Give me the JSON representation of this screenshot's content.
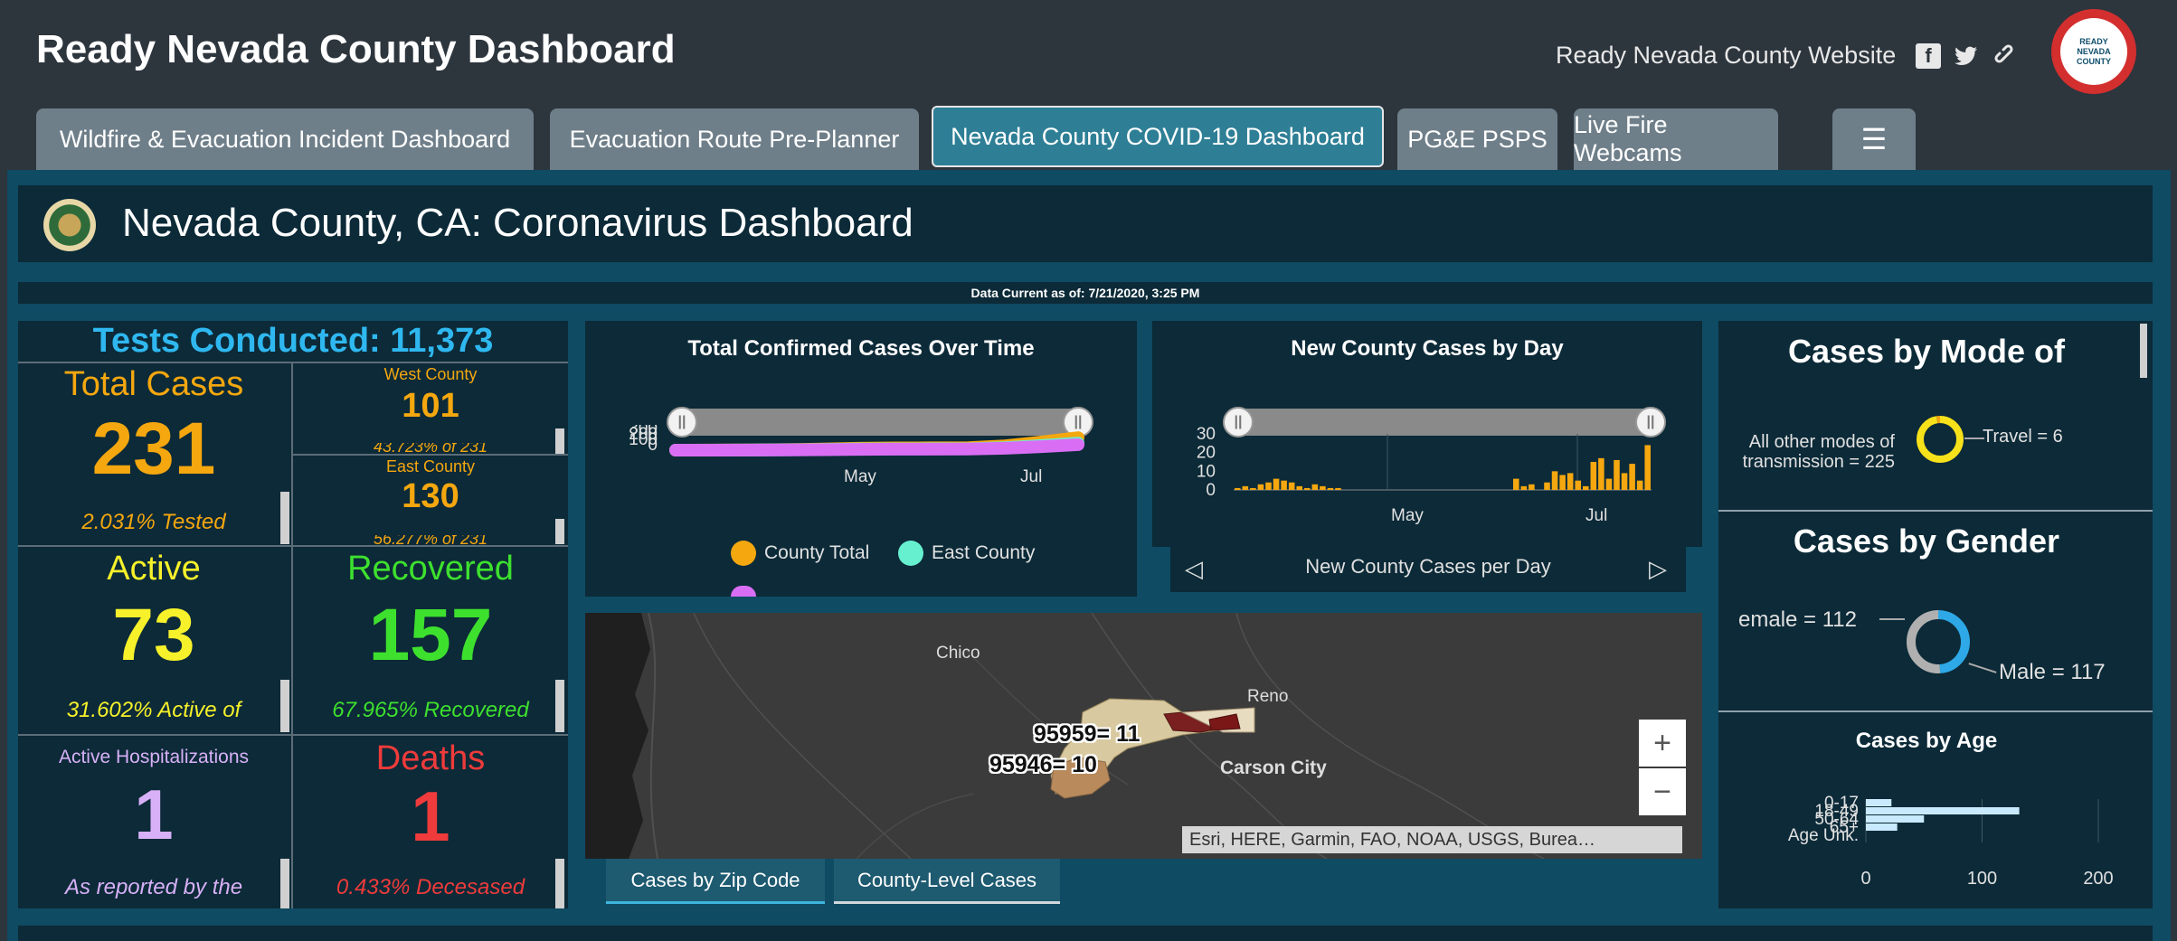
{
  "header": {
    "title": "Ready Nevada County Dashboard",
    "website_link": "Ready Nevada County Website",
    "social": {
      "facebook": "f",
      "twitter": "t",
      "link": "⛓"
    },
    "logo_text": [
      "READY",
      "NEVADA",
      "COUNTY"
    ]
  },
  "tabs": [
    {
      "label": "Wildfire & Evacuation Incident Dashboard",
      "active": false
    },
    {
      "label": "Evacuation Route Pre-Planner",
      "active": false
    },
    {
      "label": "Nevada County COVID-19 Dashboard",
      "active": true
    },
    {
      "label": "PG&E PSPS",
      "active": false
    },
    {
      "label": "Live Fire Webcams",
      "active": false
    },
    {
      "label": "☰",
      "active": false
    }
  ],
  "page": {
    "title": "Nevada County, CA: Coronavirus Dashboard",
    "data_current": "Data Current as of: 7/21/2020, 3:25 PM"
  },
  "stats": {
    "tests_conducted": "Tests Conducted: 11,373",
    "total_cases": {
      "label": "Total Cases",
      "value": "231",
      "sub": "2.031% Tested"
    },
    "west_county": {
      "label": "West County",
      "value": "101",
      "sub": "43.723% of 231"
    },
    "east_county": {
      "label": "East County",
      "value": "130",
      "sub": "56.277% of 231"
    },
    "active": {
      "label": "Active",
      "value": "73",
      "sub": "31.602% Active of"
    },
    "recovered": {
      "label": "Recovered",
      "value": "157",
      "sub": "67.965% Recovered"
    },
    "hospitalizations": {
      "label": "Active Hospitalizations",
      "value": "1",
      "sub": "As reported by the"
    },
    "deaths": {
      "label": "Deaths",
      "value": "1",
      "sub": "0.433% Decesased"
    }
  },
  "colors": {
    "tests": "#2fb8f0",
    "total": "#f4a70f",
    "active": "#f6f12a",
    "recovered": "#3ee02e",
    "hosp": "#d7b0f7",
    "deaths": "#ef3b3b"
  },
  "chart_data": [
    {
      "type": "line",
      "title": "Total Confirmed Cases Over Time",
      "ylim": [
        0,
        200
      ],
      "y_ticks": [
        "300",
        "200",
        "100",
        "0"
      ],
      "x_ticks": [
        "May",
        "Jul"
      ],
      "series": [
        {
          "name": "County Total",
          "color": "#f4a70f",
          "values": [
            0,
            2,
            5,
            10,
            20,
            35,
            41,
            43,
            45,
            80,
            150,
            231
          ]
        },
        {
          "name": "East County",
          "color": "#66f0d0",
          "values": [
            0,
            1,
            3,
            6,
            12,
            20,
            22,
            24,
            25,
            45,
            85,
            130
          ]
        },
        {
          "name": "",
          "color": "#d96ef5",
          "values": [
            0,
            1,
            2,
            4,
            8,
            15,
            19,
            19,
            20,
            35,
            65,
            101
          ]
        }
      ],
      "legend": [
        "County Total",
        "East County"
      ]
    },
    {
      "type": "bar",
      "title": "New County Cases by Day",
      "ylim": [
        0,
        30
      ],
      "y_ticks": [
        "30",
        "20",
        "10",
        "0"
      ],
      "x_ticks": [
        "May",
        "Jul"
      ],
      "values": [
        1,
        2,
        1,
        3,
        4,
        6,
        5,
        4,
        2,
        1,
        3,
        2,
        1,
        1,
        0,
        0,
        0,
        0,
        0,
        0,
        0,
        0,
        0,
        0,
        0,
        0,
        0,
        0,
        0,
        0,
        0,
        0,
        0,
        0,
        0,
        0,
        6,
        2,
        3,
        0,
        4,
        10,
        8,
        9,
        5,
        2,
        15,
        17,
        6,
        16,
        9,
        14,
        5,
        24
      ],
      "footer": "New County Cases per Day"
    },
    {
      "type": "pie",
      "title": "Cases by Mode of",
      "labels": [
        "All other modes of transmission = 225",
        "Travel = 6"
      ],
      "values": [
        225,
        6
      ]
    },
    {
      "type": "pie",
      "title": "Cases by Gender",
      "labels": [
        "emale = 112",
        "Male = 117"
      ],
      "values": [
        112,
        117
      ]
    },
    {
      "type": "bar",
      "title": "Cases by Age",
      "categories": [
        "0-17",
        "18-49",
        "50-64",
        "65+",
        "Age Unk."
      ],
      "values": [
        22,
        132,
        50,
        27,
        0
      ],
      "x_ticks": [
        "0",
        "100",
        "200"
      ],
      "xlim": [
        0,
        200
      ]
    }
  ],
  "map": {
    "cities": [
      "Chico",
      "Reno",
      "Carson City"
    ],
    "zip_labels": [
      "95959= 11",
      "95946= 10"
    ],
    "attribution": "Esri, HERE, Garmin, FAO, NOAA, USGS, Burea…",
    "zoom_in": "+",
    "zoom_out": "−",
    "tabs": [
      "Cases by Zip Code",
      "County-Level Cases"
    ]
  },
  "nav_arrows": {
    "prev": "◁",
    "next": "▷"
  }
}
